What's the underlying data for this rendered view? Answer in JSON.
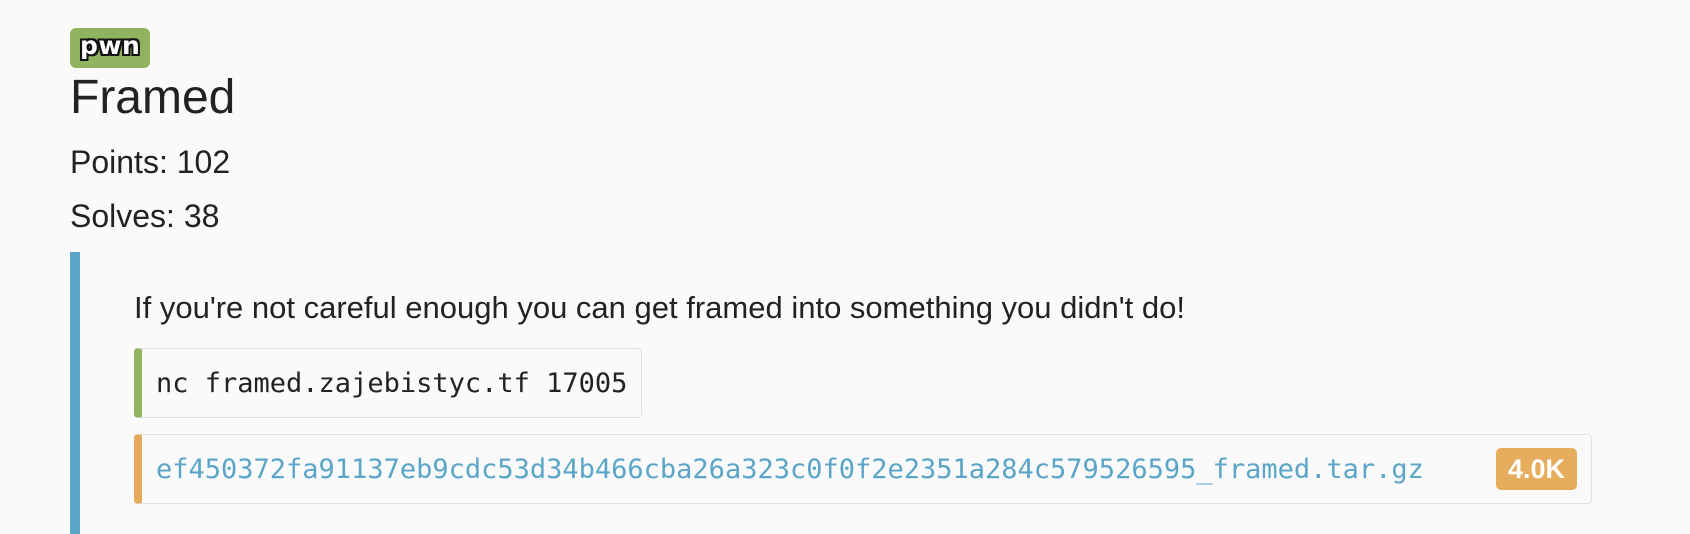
{
  "challenge": {
    "category": "pwn",
    "title": "Framed",
    "points_label": "Points: 102",
    "solves_label": "Solves: 38",
    "description": "If you're not careful enough you can get framed into something you didn't do!",
    "connection": "nc framed.zajebistyc.tf 17005",
    "attachment": {
      "filename": "ef450372fa91137eb9cdc53d34b466cba26a323c0f0f2e2351a284c579526595_framed.tar.gz",
      "size": "4.0K"
    }
  },
  "colors": {
    "category_badge": "#8fb35f",
    "description_border": "#5aa5c8",
    "connection_border": "#8fb35f",
    "attachment_border": "#e6a85a",
    "link": "#5aa5c8",
    "size_badge": "#e6ad5c",
    "background": "#fafafa"
  }
}
